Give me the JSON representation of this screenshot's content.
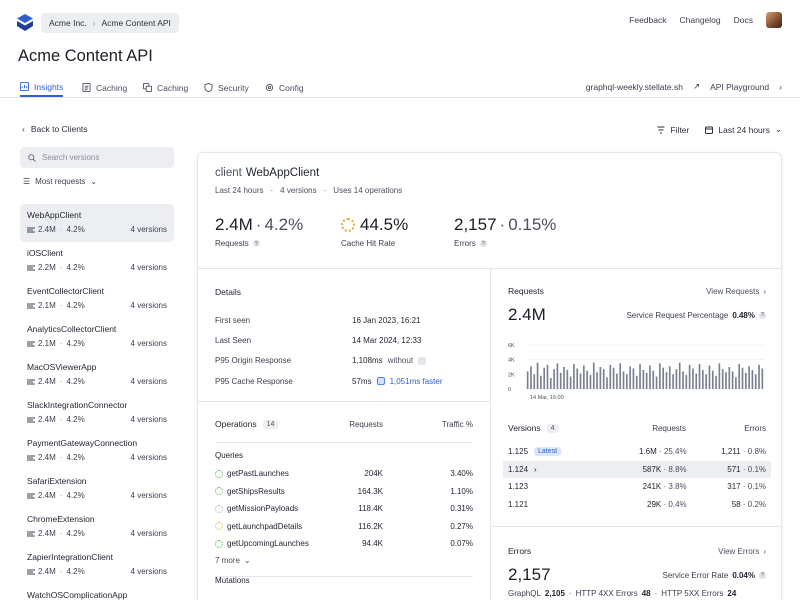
{
  "header": {
    "breadcrumb": [
      "Acme Inc.",
      "Acme Content API"
    ],
    "links": [
      "Feedback",
      "Changelog",
      "Docs"
    ]
  },
  "page_title": "Acme Content API",
  "tabs": [
    {
      "label": "Insights",
      "icon": "chart-icon",
      "active": true
    },
    {
      "label": "Caching",
      "icon": "document-icon"
    },
    {
      "label": "Caching",
      "icon": "copy-icon"
    },
    {
      "label": "Security",
      "icon": "shield-icon"
    },
    {
      "label": "Config",
      "icon": "gear-icon"
    }
  ],
  "tab_links": {
    "endpoint": "graphql-weekly.stellate.sh",
    "playground": "API Playground"
  },
  "back_label": "Back to Clients",
  "filter": {
    "filter_label": "Filter",
    "range_label": "Last 24 hours"
  },
  "sidebar": {
    "search_placeholder": "Search versions",
    "sort_label": "Most requests",
    "clients": [
      {
        "name": "WebAppClient",
        "requests": "2.4M",
        "pct": "4.2%",
        "versions": "4 versions",
        "active": true
      },
      {
        "name": "iOSClient",
        "requests": "2.2M",
        "pct": "4.2%",
        "versions": "4 versions"
      },
      {
        "name": "EventCollectorClient",
        "requests": "2.1M",
        "pct": "4.2%",
        "versions": "4 versions"
      },
      {
        "name": "AnalyticsCollectorClient",
        "requests": "2.1M",
        "pct": "4.2%",
        "versions": "4 versions"
      },
      {
        "name": "MacOSViewerApp",
        "requests": "2.4M",
        "pct": "4.2%",
        "versions": "4 versions"
      },
      {
        "name": "SlackIntegrationConnector",
        "requests": "2.4M",
        "pct": "4.2%",
        "versions": "4 versions"
      },
      {
        "name": "PaymentGatewayConnection",
        "requests": "2.4M",
        "pct": "4.2%",
        "versions": "4 versions"
      },
      {
        "name": "SafariExtension",
        "requests": "2.4M",
        "pct": "4.2%",
        "versions": "4 versions"
      },
      {
        "name": "ChromeExtension",
        "requests": "2.4M",
        "pct": "4.2%",
        "versions": "4 versions"
      },
      {
        "name": "ZapierIntegrationClient",
        "requests": "2.4M",
        "pct": "4.2%",
        "versions": "4 versions"
      },
      {
        "name": "WatchOSComplicationApp",
        "requests": "",
        "pct": "",
        "versions": ""
      }
    ]
  },
  "client": {
    "label": "client",
    "name": "WebAppClient",
    "sub": [
      "Last 24 hours",
      "4 versions",
      "Uses 14 operations"
    ],
    "stats": [
      {
        "value": "2.4M",
        "pct": "4.2%",
        "label": "Requests"
      },
      {
        "value": "44.5%",
        "label": "Cache Hit Rate"
      },
      {
        "value": "2,157",
        "pct": "0.15%",
        "label": "Errors"
      }
    ]
  },
  "details": {
    "title": "Details",
    "rows": [
      {
        "k": "First seen",
        "v": "16 Jan 2023, 16:21"
      },
      {
        "k": "Last Seen",
        "v": "14 Mar 2024, 12:33"
      },
      {
        "k": "P95 Origin Response",
        "v": "1,108ms",
        "extra": "without"
      },
      {
        "k": "P95 Cache Response",
        "v": "57ms",
        "extra": "1,051ms faster"
      }
    ]
  },
  "operations": {
    "title": "Operations",
    "count": "14",
    "col_requests": "Requests",
    "col_traffic": "Traffic %",
    "group_queries": "Queries",
    "rows": [
      {
        "name": "getPastLaunches",
        "requests": "204K",
        "traffic": "3.40%",
        "status": "green"
      },
      {
        "name": "getShipsResults",
        "requests": "164.3K",
        "traffic": "1.10%",
        "status": "green"
      },
      {
        "name": "getMissionPayloads",
        "requests": "118.4K",
        "traffic": "0.31%",
        "status": "gray"
      },
      {
        "name": "getLaunchpadDetails",
        "requests": "116.2K",
        "traffic": "0.27%",
        "status": "yellow"
      },
      {
        "name": "getUpcomingLaunches",
        "requests": "94.4K",
        "traffic": "0.07%",
        "status": "green"
      }
    ],
    "more": "7 more",
    "group_mutations": "Mutations"
  },
  "requests_panel": {
    "title": "Requests",
    "link": "View Requests",
    "value": "2.4M",
    "metric_label": "Service Request Percentage",
    "metric_value": "0.48%"
  },
  "chart_data": {
    "type": "bar",
    "ylabel": "",
    "yticks": [
      "6K",
      "4K",
      "2K",
      "0"
    ],
    "ylim": [
      0,
      6000
    ],
    "x_first_label": "14 Mar, 16:00",
    "values": [
      2400,
      3100,
      2000,
      3600,
      1800,
      2900,
      3300,
      1500,
      2700,
      3500,
      2200,
      3000,
      2600,
      1700,
      3400,
      2800,
      2100,
      3200,
      2500,
      1900,
      3600,
      2300,
      3000,
      2700,
      1600,
      3300,
      2900,
      2100,
      3500,
      2400,
      2000,
      3100,
      2800,
      1800,
      3400,
      2600,
      2200,
      3200,
      2500,
      1700,
      3500,
      2900,
      2300,
      3100,
      2000,
      2700,
      3600,
      2400,
      1900,
      3300,
      2800,
      2100,
      3400,
      2600,
      2000,
      3200,
      2500,
      1800,
      3500,
      2700,
      2300,
      3000,
      2400,
      1600,
      3400,
      2900,
      2200,
      3100,
      2600,
      2000,
      3300,
      2800
    ]
  },
  "versions": {
    "title": "Versions",
    "count": "4",
    "col_requests": "Requests",
    "col_errors": "Errors",
    "latest_label": "Latest",
    "rows": [
      {
        "name": "1.125",
        "req": "1.6M",
        "reqpct": "25.4%",
        "err": "1,211",
        "errpct": "0.8%",
        "latest": true
      },
      {
        "name": "1.124",
        "req": "587K",
        "reqpct": "8.8%",
        "err": "571",
        "errpct": "0.1%",
        "highlight": true
      },
      {
        "name": "1.123",
        "req": "241K",
        "reqpct": "3.8%",
        "err": "317",
        "errpct": "0.1%"
      },
      {
        "name": "1.121",
        "req": "29K",
        "reqpct": "0.4%",
        "err": "58",
        "errpct": "0.2%"
      }
    ]
  },
  "errors_panel": {
    "title": "Errors",
    "link": "View Errors",
    "value": "2,157",
    "metric_label": "Service Error Rate",
    "metric_value": "0.04%",
    "line": [
      {
        "label": "GraphQL",
        "value": "2,105"
      },
      {
        "label": "HTTP 4XX Errors",
        "value": "48"
      },
      {
        "label": "HTTP 5XX Errors",
        "value": "24"
      }
    ]
  },
  "colors": {
    "accent": "#2f5fd0",
    "bar": "#7a8090"
  }
}
